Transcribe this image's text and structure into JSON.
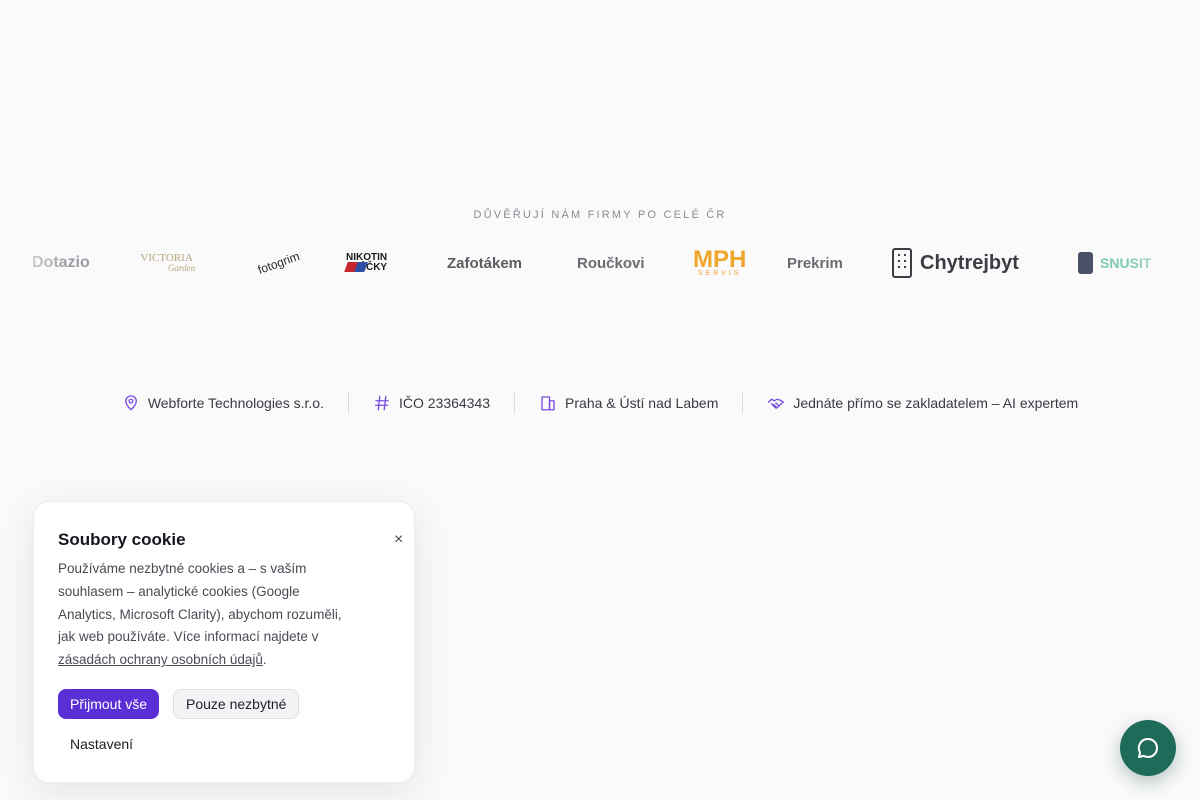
{
  "trusted": {
    "heading": "DŮVĚŘUJÍ NÁM FIRMY PO CELÉ ČR",
    "logos": {
      "dotazio": "Dotazio",
      "victoria_main": "VICTORIA",
      "victoria_sub": "Garden",
      "fotogrim": "fotogrim",
      "nikotin_top": "NIKOTIN",
      "nikotin_bottom": "SÁČKY",
      "zafotakem": "Zafotákem",
      "rouckovi": "Roučkovi",
      "mph_main": "MPH",
      "mph_sub": "SERVIS",
      "prekrim": "Prekrim",
      "chytrejbyt": "Chytrejbyt",
      "snusit": "SNUSIT"
    }
  },
  "info_bar": {
    "company": "Webforte Technologies s.r.o.",
    "ico": "IČO 23364343",
    "location": "Praha & Ústí nad Labem",
    "founder": "Jednáte přímo se zakladatelem – AI expertem"
  },
  "cookie": {
    "title": "Soubory cookie",
    "close_symbol": "×",
    "text": "Používáme nezbytné cookies a – s vaším souhlasem – analytické cookies (Google Analytics, Microsoft Clarity), abychom rozuměli, jak web používáte. Více informací najdete v ",
    "link_text": "zásadách ochrany osobních údajů",
    "text_end": ".",
    "accept_label": "Přijmout vše",
    "necessary_label": "Pouze nezbytné",
    "settings_label": "Nastavení"
  },
  "icons": {
    "location": "map-pin-icon",
    "hash": "hash-icon",
    "building": "building-icon",
    "handshake": "handshake-icon",
    "chat": "chat-bubble-icon"
  },
  "colors": {
    "accent": "#5b2fd6",
    "chat": "#1f6b5a",
    "icon": "#7a4fe0"
  }
}
